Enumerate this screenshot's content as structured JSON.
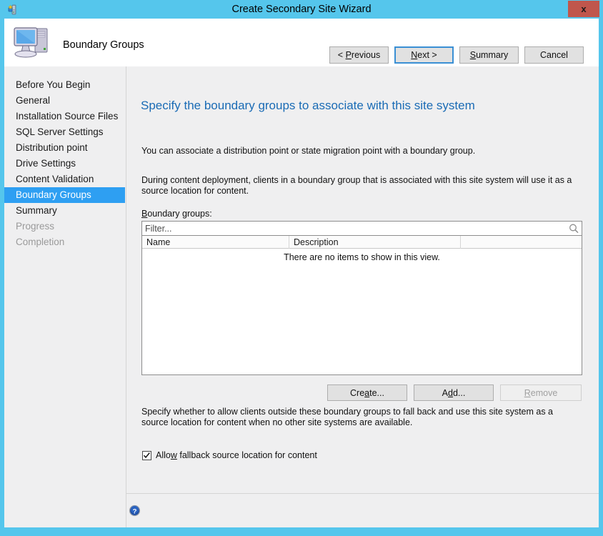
{
  "window": {
    "title": "Create Secondary Site Wizard",
    "app_icon": "site-server-icon",
    "close_label": "x",
    "frame_color": "#55c6ec",
    "titlebar_color": "#55c6ec",
    "close_button_color": "#c0564c"
  },
  "header": {
    "title": "Boundary Groups",
    "icon": "computer-icon"
  },
  "sidebar": {
    "items": [
      {
        "label": "Before You Begin",
        "state": "normal"
      },
      {
        "label": "General",
        "state": "normal"
      },
      {
        "label": "Installation Source Files",
        "state": "normal"
      },
      {
        "label": "SQL Server Settings",
        "state": "normal"
      },
      {
        "label": "Distribution point",
        "state": "normal"
      },
      {
        "label": "Drive Settings",
        "state": "normal"
      },
      {
        "label": "Content Validation",
        "state": "normal"
      },
      {
        "label": "Boundary Groups",
        "state": "selected"
      },
      {
        "label": "Summary",
        "state": "normal"
      },
      {
        "label": "Progress",
        "state": "disabled"
      },
      {
        "label": "Completion",
        "state": "disabled"
      }
    ],
    "selected_color": "#2e9ff2"
  },
  "main": {
    "heading": "Specify the boundary groups to associate with this site system",
    "heading_color": "#1a6bb5",
    "paragraph1": "You can associate a distribution point or state migration point with a boundary group.",
    "paragraph2": "During content deployment, clients in a boundary group that is associated with this site system will use it as a source location for content.",
    "paragraph3": "Specify whether to allow clients outside these boundary groups to fall back and use this site system as a source location for content when no other site systems are available.",
    "field_label": "Boundary groups:",
    "field_label_accelerator": "B",
    "filter": {
      "placeholder": "Filter...",
      "value": "",
      "icon": "search-icon"
    },
    "listview": {
      "columns": [
        "Name",
        "Description"
      ],
      "rows": [],
      "empty_message": "There are no items to show in this view."
    },
    "buttons": [
      {
        "label": "Create...",
        "accelerator": "a",
        "enabled": true
      },
      {
        "label": "Add...",
        "accelerator": "d",
        "enabled": true
      },
      {
        "label": "Remove",
        "accelerator": "R",
        "enabled": false
      }
    ],
    "checkbox": {
      "label": "Allow fallback source location for content",
      "accelerator": "w",
      "checked": true
    }
  },
  "footer": {
    "help_icon": "help-icon",
    "buttons": [
      {
        "label": "< Previous",
        "accelerator": "P",
        "focused": false
      },
      {
        "label": "Next >",
        "accelerator": "N",
        "focused": true
      },
      {
        "label": "Summary",
        "accelerator": "S",
        "focused": false
      },
      {
        "label": "Cancel",
        "accelerator": "",
        "focused": false
      }
    ]
  }
}
